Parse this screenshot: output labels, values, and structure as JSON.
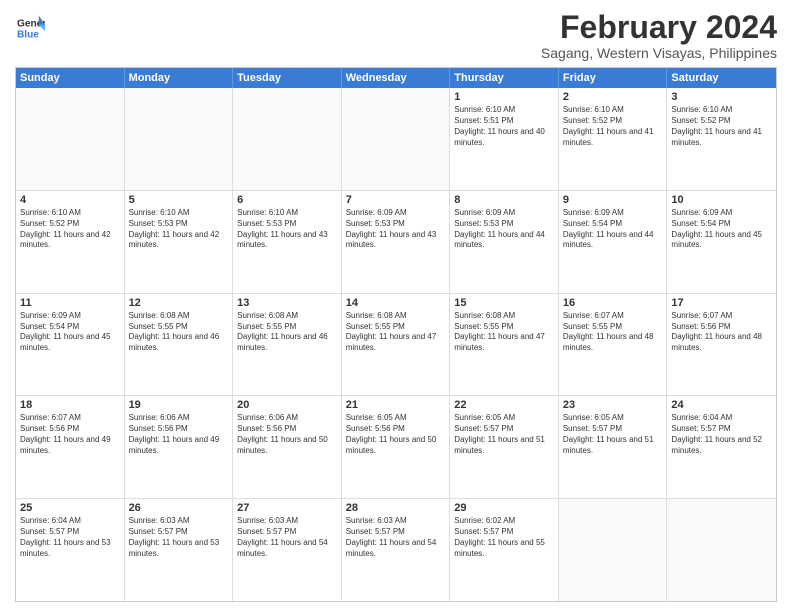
{
  "logo": {
    "general": "General",
    "blue": "Blue"
  },
  "header": {
    "month": "February 2024",
    "location": "Sagang, Western Visayas, Philippines"
  },
  "days": [
    "Sunday",
    "Monday",
    "Tuesday",
    "Wednesday",
    "Thursday",
    "Friday",
    "Saturday"
  ],
  "weeks": [
    [
      {
        "day": "",
        "empty": true
      },
      {
        "day": "",
        "empty": true
      },
      {
        "day": "",
        "empty": true
      },
      {
        "day": "",
        "empty": true
      },
      {
        "day": "1",
        "sunrise": "6:10 AM",
        "sunset": "5:51 PM",
        "daylight": "11 hours and 40 minutes."
      },
      {
        "day": "2",
        "sunrise": "6:10 AM",
        "sunset": "5:52 PM",
        "daylight": "11 hours and 41 minutes."
      },
      {
        "day": "3",
        "sunrise": "6:10 AM",
        "sunset": "5:52 PM",
        "daylight": "11 hours and 41 minutes."
      }
    ],
    [
      {
        "day": "4",
        "sunrise": "6:10 AM",
        "sunset": "5:52 PM",
        "daylight": "11 hours and 42 minutes."
      },
      {
        "day": "5",
        "sunrise": "6:10 AM",
        "sunset": "5:53 PM",
        "daylight": "11 hours and 42 minutes."
      },
      {
        "day": "6",
        "sunrise": "6:10 AM",
        "sunset": "5:53 PM",
        "daylight": "11 hours and 43 minutes."
      },
      {
        "day": "7",
        "sunrise": "6:09 AM",
        "sunset": "5:53 PM",
        "daylight": "11 hours and 43 minutes."
      },
      {
        "day": "8",
        "sunrise": "6:09 AM",
        "sunset": "5:53 PM",
        "daylight": "11 hours and 44 minutes."
      },
      {
        "day": "9",
        "sunrise": "6:09 AM",
        "sunset": "5:54 PM",
        "daylight": "11 hours and 44 minutes."
      },
      {
        "day": "10",
        "sunrise": "6:09 AM",
        "sunset": "5:54 PM",
        "daylight": "11 hours and 45 minutes."
      }
    ],
    [
      {
        "day": "11",
        "sunrise": "6:09 AM",
        "sunset": "5:54 PM",
        "daylight": "11 hours and 45 minutes."
      },
      {
        "day": "12",
        "sunrise": "6:08 AM",
        "sunset": "5:55 PM",
        "daylight": "11 hours and 46 minutes."
      },
      {
        "day": "13",
        "sunrise": "6:08 AM",
        "sunset": "5:55 PM",
        "daylight": "11 hours and 46 minutes."
      },
      {
        "day": "14",
        "sunrise": "6:08 AM",
        "sunset": "5:55 PM",
        "daylight": "11 hours and 47 minutes."
      },
      {
        "day": "15",
        "sunrise": "6:08 AM",
        "sunset": "5:55 PM",
        "daylight": "11 hours and 47 minutes."
      },
      {
        "day": "16",
        "sunrise": "6:07 AM",
        "sunset": "5:55 PM",
        "daylight": "11 hours and 48 minutes."
      },
      {
        "day": "17",
        "sunrise": "6:07 AM",
        "sunset": "5:56 PM",
        "daylight": "11 hours and 48 minutes."
      }
    ],
    [
      {
        "day": "18",
        "sunrise": "6:07 AM",
        "sunset": "5:56 PM",
        "daylight": "11 hours and 49 minutes."
      },
      {
        "day": "19",
        "sunrise": "6:06 AM",
        "sunset": "5:56 PM",
        "daylight": "11 hours and 49 minutes."
      },
      {
        "day": "20",
        "sunrise": "6:06 AM",
        "sunset": "5:56 PM",
        "daylight": "11 hours and 50 minutes."
      },
      {
        "day": "21",
        "sunrise": "6:05 AM",
        "sunset": "5:56 PM",
        "daylight": "11 hours and 50 minutes."
      },
      {
        "day": "22",
        "sunrise": "6:05 AM",
        "sunset": "5:57 PM",
        "daylight": "11 hours and 51 minutes."
      },
      {
        "day": "23",
        "sunrise": "6:05 AM",
        "sunset": "5:57 PM",
        "daylight": "11 hours and 51 minutes."
      },
      {
        "day": "24",
        "sunrise": "6:04 AM",
        "sunset": "5:57 PM",
        "daylight": "11 hours and 52 minutes."
      }
    ],
    [
      {
        "day": "25",
        "sunrise": "6:04 AM",
        "sunset": "5:57 PM",
        "daylight": "11 hours and 53 minutes."
      },
      {
        "day": "26",
        "sunrise": "6:03 AM",
        "sunset": "5:57 PM",
        "daylight": "11 hours and 53 minutes."
      },
      {
        "day": "27",
        "sunrise": "6:03 AM",
        "sunset": "5:57 PM",
        "daylight": "11 hours and 54 minutes."
      },
      {
        "day": "28",
        "sunrise": "6:03 AM",
        "sunset": "5:57 PM",
        "daylight": "11 hours and 54 minutes."
      },
      {
        "day": "29",
        "sunrise": "6:02 AM",
        "sunset": "5:57 PM",
        "daylight": "11 hours and 55 minutes."
      },
      {
        "day": "",
        "empty": true
      },
      {
        "day": "",
        "empty": true
      }
    ]
  ]
}
